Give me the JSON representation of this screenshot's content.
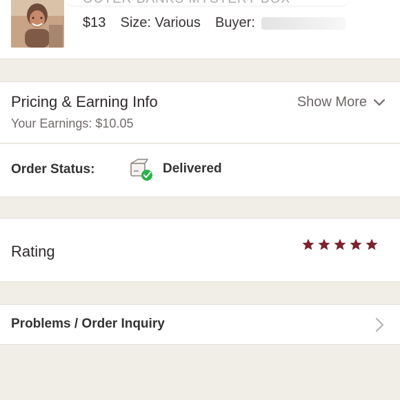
{
  "order": {
    "title": "OUTER BANKS MYSTERY BOX",
    "price": "$13",
    "size_text": "Size: Various",
    "buyer_label": "Buyer:"
  },
  "pricing": {
    "title": "Pricing & Earning Info",
    "earnings_text": "Your Earnings: $10.05",
    "show_more_label": "Show More"
  },
  "status": {
    "label": "Order Status:",
    "value": "Delivered"
  },
  "rating": {
    "label": "Rating",
    "stars": 5,
    "max": 5,
    "star_color": "#7b2430"
  },
  "problems": {
    "label": "Problems / Order Inquiry"
  },
  "colors": {
    "background": "#f1eee8",
    "card": "#ffffff",
    "delivered_check": "#28b34a",
    "text_primary": "#2f2a2a",
    "text_secondary": "#736b6b"
  }
}
